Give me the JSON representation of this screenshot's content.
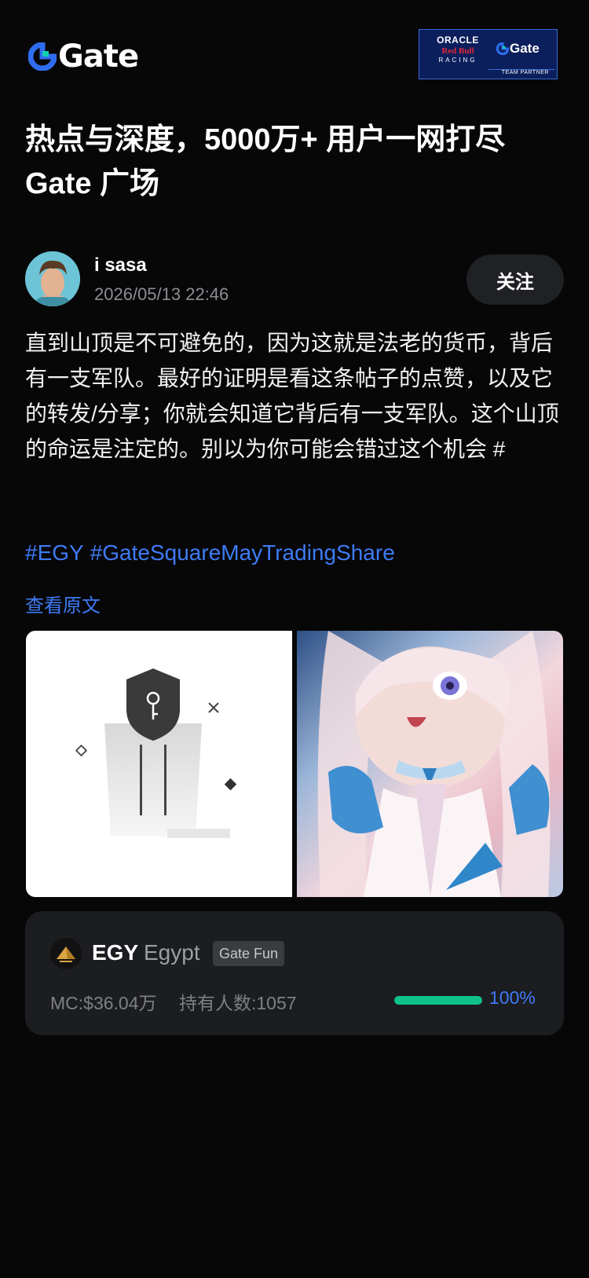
{
  "brand": {
    "name": "Gate",
    "accent": "#2f6df0"
  },
  "partner_banner": {
    "line1": "ORACLE",
    "line2": "Red Bull",
    "line3": "RACING",
    "brand": "Gate",
    "tagline": "TEAM PARTNER"
  },
  "headline": "热点与深度，5000万+ 用户一网打尽 Gate 广场",
  "post": {
    "author": "i sasa",
    "timestamp": "2026/05/13 22:46",
    "follow_label": "关注",
    "body": "直到山顶是不可避免的，因为这就是法老的货币，背后有一支军队。最好的证明是看这条帖子的点赞，以及它的转发/分享；你就会知道它背后有一支军队。这个山顶的命运是注定的。别以为你可能会错过这个机会 #",
    "hashtags": [
      "#EGY",
      "#GateSquareMayTradingShare"
    ],
    "view_original": "查看原文",
    "images": [
      "shield-key-illustration",
      "anime-character-art"
    ]
  },
  "token": {
    "symbol": "EGY",
    "name": "Egypt",
    "badge": "Gate Fun",
    "market_cap": "MC:$36.04万",
    "holders": "持有人数:1057",
    "progress_label": "100%",
    "progress": 1.0,
    "progress_color": "#0fc28a",
    "link_color": "#3e7bf5"
  }
}
